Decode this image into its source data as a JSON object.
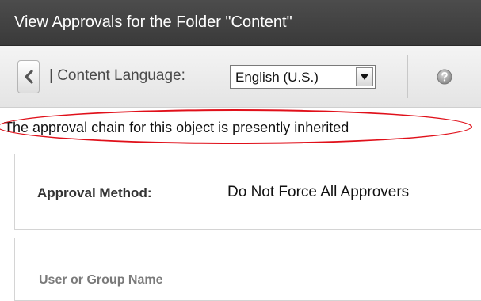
{
  "window": {
    "title": "View Approvals for the Folder \"Content\""
  },
  "toolbar": {
    "back_icon": "chevron-left-icon",
    "language_label": "| Content Language:",
    "language_selected": "English (U.S.)",
    "help_icon": "help-icon"
  },
  "notice": {
    "text": "The approval chain for this object is presently inherited",
    "highlight_color": "#e0101a"
  },
  "approval": {
    "method_label": "Approval Method:",
    "method_value": "Do Not Force All Approvers"
  },
  "table": {
    "column_header": "User or Group Name"
  },
  "colors": {
    "titlebar": "#3f3f3f",
    "toolbar": "#ececec"
  }
}
